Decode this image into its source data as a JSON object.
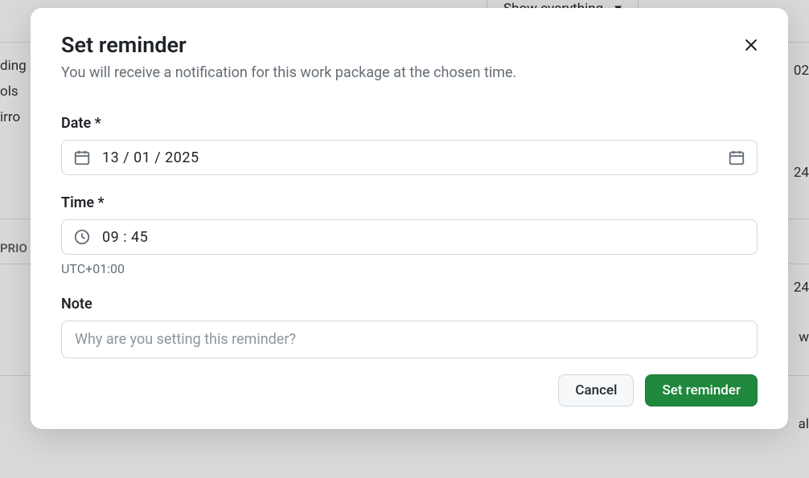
{
  "background": {
    "text1": "ding",
    "text2": "ols",
    "text3": "irro",
    "text4": "PRIO",
    "text5": "02",
    "text6": "24",
    "text7": "24",
    "text8": "w",
    "text9": "al",
    "dropdown_label": "Show everything"
  },
  "modal": {
    "title": "Set reminder",
    "subtitle": "You will receive a notification for this work package at the chosen time.",
    "date": {
      "label": "Date *",
      "value": "13 / 01 / 2025"
    },
    "time": {
      "label": "Time *",
      "value": "09 : 45",
      "timezone": "UTC+01:00"
    },
    "note": {
      "label": "Note",
      "placeholder": "Why are you setting this reminder?"
    },
    "buttons": {
      "cancel": "Cancel",
      "submit": "Set reminder"
    }
  }
}
